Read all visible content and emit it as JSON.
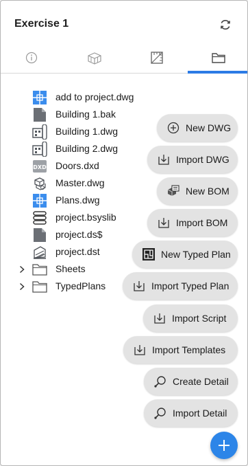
{
  "header": {
    "title": "Exercise 1",
    "refresh_icon": "refresh-icon"
  },
  "tabs": [
    {
      "name": "info",
      "icon": "info-icon",
      "selected": false
    },
    {
      "name": "model",
      "icon": "3d-block-icon",
      "selected": false
    },
    {
      "name": "sheet",
      "icon": "sheet-drawing-icon",
      "selected": false
    },
    {
      "name": "project-files",
      "icon": "folder-icon",
      "selected": true
    }
  ],
  "files": [
    {
      "label": "add to project.dwg",
      "icon": "plan-dwg-icon"
    },
    {
      "label": "Building 1.bak",
      "icon": "generic-file-icon"
    },
    {
      "label": "Building 1.dwg",
      "icon": "building-dwg-icon"
    },
    {
      "label": "Building 2.dwg",
      "icon": "building-dwg-icon"
    },
    {
      "label": "Doors.dxd",
      "icon": "dxd-icon"
    },
    {
      "label": "Master.dwg",
      "icon": "master-model-icon"
    },
    {
      "label": "Plans.dwg",
      "icon": "plan-dwg-icon"
    },
    {
      "label": "project.bsyslib",
      "icon": "database-icon"
    },
    {
      "label": "project.ds$",
      "icon": "generic-file-icon"
    },
    {
      "label": "project.dst",
      "icon": "sheetset-icon"
    },
    {
      "label": "Sheets",
      "icon": "folder-icon",
      "expandable": true
    },
    {
      "label": "TypedPlans",
      "icon": "folder-icon",
      "expandable": true
    }
  ],
  "actions": [
    {
      "label": "New DWG",
      "icon": "plus-circle-icon"
    },
    {
      "label": "Import DWG",
      "icon": "import-icon"
    },
    {
      "label": "New BOM",
      "icon": "bom-icon"
    },
    {
      "label": "Import BOM",
      "icon": "import-icon"
    },
    {
      "label": "New Typed Plan",
      "icon": "typed-plan-icon"
    },
    {
      "label": "Import Typed Plan",
      "icon": "import-icon"
    },
    {
      "label": "Import Script",
      "icon": "import-icon"
    },
    {
      "label": "Import Templates",
      "icon": "import-icon"
    },
    {
      "label": "Create Detail",
      "icon": "detail-magnifier-icon"
    },
    {
      "label": "Import Detail",
      "icon": "detail-magnifier-icon"
    }
  ],
  "fab": {
    "icon": "plus-icon"
  },
  "colors": {
    "accent": "#2c7be5",
    "fab": "#2c85e8",
    "button_bg": "#e3e3e3",
    "file_icon_blue": "#3b8ded",
    "file_icon_gray": "#6b6f75"
  }
}
